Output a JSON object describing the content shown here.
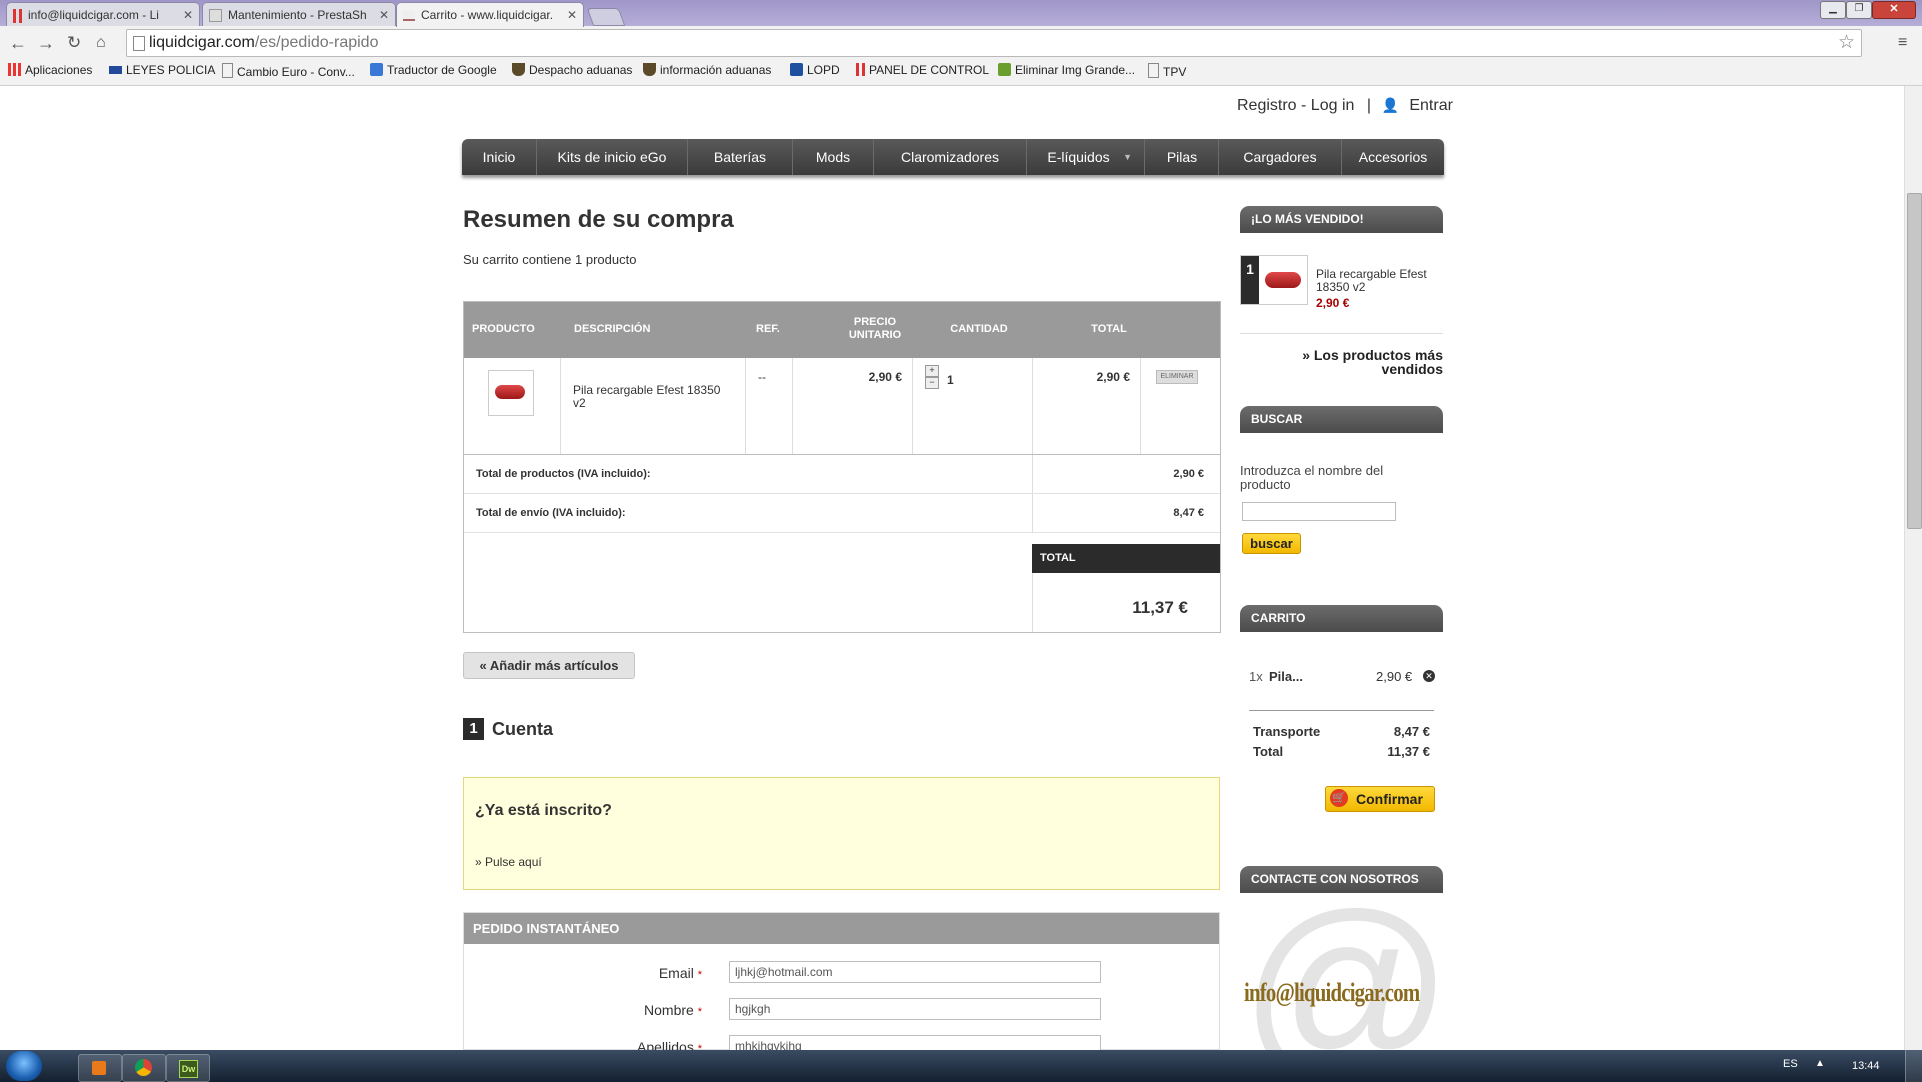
{
  "browser": {
    "tabs": [
      {
        "title": "info@liquidcigar.com - Li"
      },
      {
        "title": "Mantenimiento - PrestaSh"
      },
      {
        "title": "Carrito - www.liquidcigar."
      }
    ],
    "url_host": "liquidcigar.com",
    "url_path": "/es/pedido-rapido",
    "bookmarks": [
      "Aplicaciones",
      "LEYES POLICIA",
      "Cambio Euro - Conv...",
      "Traductor de Google",
      "Despacho aduanas",
      "información aduanas",
      "LOPD",
      "PANEL DE CONTROL",
      "Eliminar Img Grande...",
      "TPV"
    ]
  },
  "header": {
    "register_login": "Registro - Log in",
    "separator": "|",
    "enter": "Entrar"
  },
  "menu": [
    "Inicio",
    "Kits de inicio eGo",
    "Baterías",
    "Mods",
    "Claromizadores",
    "E-líquidos",
    "Pilas",
    "Cargadores",
    "Accesorios"
  ],
  "summary": {
    "title": "Resumen de su compra",
    "subtitle": "Su carrito contiene 1 producto"
  },
  "cart_table": {
    "headers": {
      "producto": "PRODUCTO",
      "descripcion": "DESCRIPCIÓN",
      "ref": "REF.",
      "precio1": "PRECIO",
      "precio2": "UNITARIO",
      "cantidad": "CANTIDAD",
      "total": "TOTAL"
    },
    "row": {
      "description": "Pila recargable Efest 18350 v2",
      "ref": "--",
      "unit_price": "2,90 €",
      "quantity": "1",
      "total": "2,90 €",
      "remove": "ELIMINAR"
    },
    "total_products_label": "Total de productos (IVA incluido):",
    "total_products_value": "2,90 €",
    "total_shipping_label": "Total de envío (IVA incluido):",
    "total_shipping_value": "8,47 €",
    "total_label": "TOTAL",
    "total_value": "11,37 €"
  },
  "add_more": "« Añadir más artículos",
  "account": {
    "step": "1",
    "title": "Cuenta",
    "registered_q": "¿Ya está inscrito?",
    "click_here": "» Pulse aquí"
  },
  "instant": {
    "title": "PEDIDO INSTANTÁNEO",
    "required_mark": "*",
    "email_label": "Email",
    "email_value": "ljhkj@hotmail.com",
    "name_label": "Nombre",
    "name_value": "hgjkgh",
    "surname_label": "Apellidos",
    "surname_value": "mhkjhgvkjhg"
  },
  "sidebar": {
    "bestsellers_title": "¡LO MÁS VENDIDO!",
    "best_rank": "1",
    "best_name": "Pila recargable Efest 18350 v2",
    "best_price": "2,90 €",
    "best_more": "» Los productos más vendidos",
    "search_title": "BUSCAR",
    "search_label": "Introduzca el nombre del producto",
    "search_button": "buscar",
    "cart_title": "CARRITO",
    "cart_qty": "1x",
    "cart_item": "Pila...",
    "cart_item_price": "2,90 €",
    "transport_label": "Transporte",
    "transport_value": "8,47 €",
    "total_label": "Total",
    "total_value": "11,37 €",
    "confirm": "Confirmar",
    "contact_title": "CONTACTE CON NOSOTROS",
    "contact_email": "info@liquidcigar.com"
  },
  "taskbar": {
    "lang": "ES",
    "time": "13:44"
  }
}
